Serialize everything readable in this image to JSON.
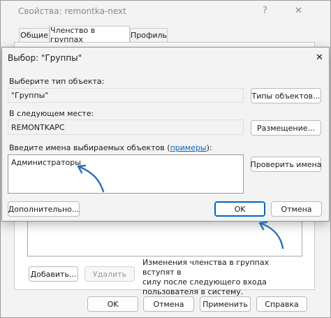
{
  "bg_window": {
    "title": "Свойства: remontka-next",
    "help_glyph": "?",
    "close_glyph": "✕",
    "tabs": [
      {
        "label": "Общие"
      },
      {
        "label": "Членство в группах"
      },
      {
        "label": "Профиль"
      }
    ],
    "add_button": "Добавить...",
    "remove_button": "Удалить",
    "note": [
      "Изменения членства в группах вступят в",
      "силу после следующего входа",
      "пользователя в систему."
    ],
    "ok": "OK",
    "cancel": "Отмена",
    "apply": "Применить",
    "help": "Справка"
  },
  "dialog": {
    "title": "Выбор: \"Группы\"",
    "close_glyph": "✕",
    "type_label": "Выберите тип объекта:",
    "type_value": "\"Группы\"",
    "types_button": "Типы объектов...",
    "location_label": "В следующем месте:",
    "location_value": "REMONTKAPC",
    "location_button": "Размещение...",
    "names_label_prefix": "Введите имена выбираемых объектов (",
    "names_link": "примеры",
    "names_label_suffix": "):",
    "names_value": "Администраторы",
    "check_button": "Проверить имена",
    "advanced_button": "Дополнительно...",
    "ok": "OK",
    "cancel": "Отмена"
  },
  "colors": {
    "accent": "#0067c0",
    "arrow": "#2a6fb6",
    "link": "#0066cc"
  }
}
